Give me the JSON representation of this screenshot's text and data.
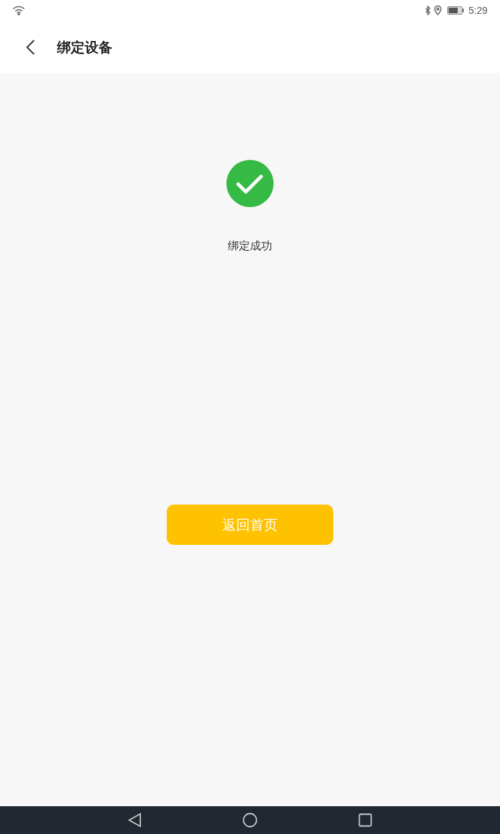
{
  "status_bar": {
    "time": "5:29"
  },
  "header": {
    "title": "绑定设备"
  },
  "result": {
    "message": "绑定成功"
  },
  "home_button": {
    "label": "返回首页"
  }
}
